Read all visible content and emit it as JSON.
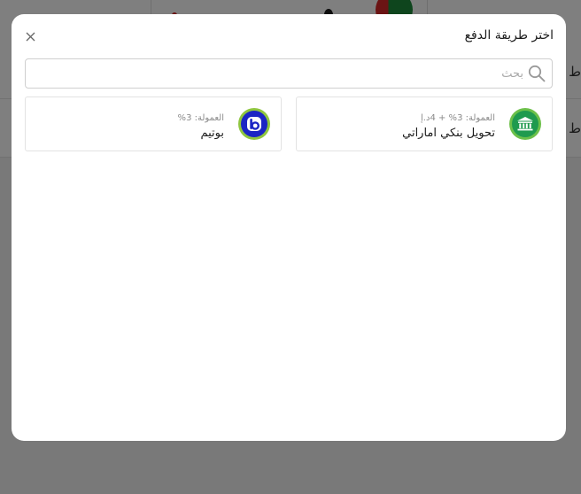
{
  "background": {
    "tab_text_1": "ط",
    "tab_text_2": "ط"
  },
  "modal": {
    "title": "اختر طريقة الدفع",
    "close_icon": "close-icon",
    "search": {
      "placeholder": "بحث",
      "value": "",
      "icon": "search-icon"
    },
    "methods": [
      {
        "name": "تحويل بنكي اماراتي",
        "fee": "العمولة: 3% + 4د.إ",
        "icon": "bank-icon",
        "logo_color": "#1f9a4e"
      },
      {
        "name": "بوتيم",
        "fee": "العمولة: 3%",
        "icon": "botim-icon",
        "logo_color": "#1b25c4"
      }
    ]
  }
}
